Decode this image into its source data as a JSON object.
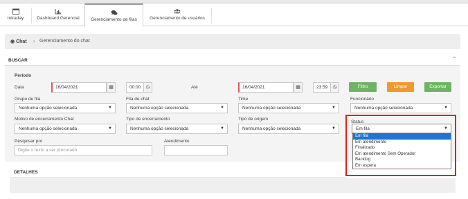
{
  "tabs": [
    {
      "label": "Intraday",
      "icon": "calendar-icon"
    },
    {
      "label": "Dashboard Gerencial",
      "icon": "bar-chart-icon"
    },
    {
      "label": "Gerenciamento de filas",
      "icon": "chat-icon",
      "active": true
    },
    {
      "label": "Gerenciamento de usuários",
      "icon": "users-icon"
    }
  ],
  "breadcrumb": {
    "root": "Chat",
    "current": "Gerenciamento do chat"
  },
  "search": {
    "title": "BUSCAR",
    "periodo": "Período",
    "data_label": "Data",
    "ate_label": "Até",
    "date_from": "16/04/2021",
    "time_from": "00:00",
    "date_to": "16/04/2021",
    "time_to": "23:59",
    "filtro": "Filtro",
    "limpar": "Limpar",
    "exportar": "Exportar",
    "grupo_fila_label": "Grupo de fila",
    "fila_chat_label": "Fila de chat",
    "time_label": "Time",
    "funcionario_label": "Funcionário",
    "motivo_label": "Motivo de encerramento Chat",
    "tipo_encerramento_label": "Tipo de encerramento",
    "tipo_origem_label": "Tipo de origem",
    "status_label": "Status",
    "none_selected": "Nenhuma opção selecionada",
    "status_value": "Em fila",
    "pesquisar_label": "Pesquisar por",
    "pesquisar_placeholder": "Digite o texto a ser procurado",
    "atendimento_label": "Atendimento"
  },
  "status_options": [
    "Em fila",
    "Em atendimento",
    "Finalizado",
    "Em atendimento Sem Operador",
    "Backlog",
    "Em espera"
  ],
  "details": {
    "title": "DETALHES"
  },
  "colors": {
    "filtro": "#6fb464",
    "limpar": "#ee9a2f",
    "exportar": "#6fb464",
    "highlight": "#e0201e",
    "selected_option": "#1e75d6"
  }
}
